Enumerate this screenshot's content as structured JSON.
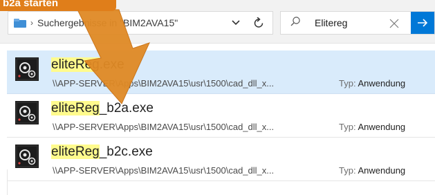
{
  "callout": {
    "text": "b2a starten",
    "color": "#e07e1a"
  },
  "address": {
    "separator": "›",
    "path": "Suchergebnisse in \"BIM2AVA15\"",
    "dropdown_icon": "chevron-down-icon",
    "refresh_icon": "refresh-icon"
  },
  "search": {
    "value": "Elitereg",
    "clear_icon": "close-icon",
    "go_icon": "arrow-right-icon",
    "accent": "#0078d7"
  },
  "results": [
    {
      "name_highlight": "eliteReg",
      "name_rest": ".exe",
      "path": "\\\\APP-SERVER\\Apps\\BIM2AVA15\\usr\\1500\\cad_dll_x...",
      "type_label": "Typ:",
      "type_value": "Anwendung",
      "selected": true
    },
    {
      "name_highlight": "eliteReg",
      "name_rest": "_b2a.exe",
      "path": "\\\\APP-SERVER\\Apps\\BIM2AVA15\\usr\\1500\\cad_dll_x...",
      "type_label": "Typ:",
      "type_value": "Anwendung",
      "selected": false
    },
    {
      "name_highlight": "eliteReg",
      "name_rest": "_b2c.exe",
      "path": "\\\\APP-SERVER\\Apps\\BIM2AVA15\\usr\\1500\\cad_dll_x...",
      "type_label": "Typ:",
      "type_value": "Anwendung",
      "selected": false
    }
  ],
  "colors": {
    "selection": "#d9ebfb",
    "highlight": "#fffb8d"
  }
}
